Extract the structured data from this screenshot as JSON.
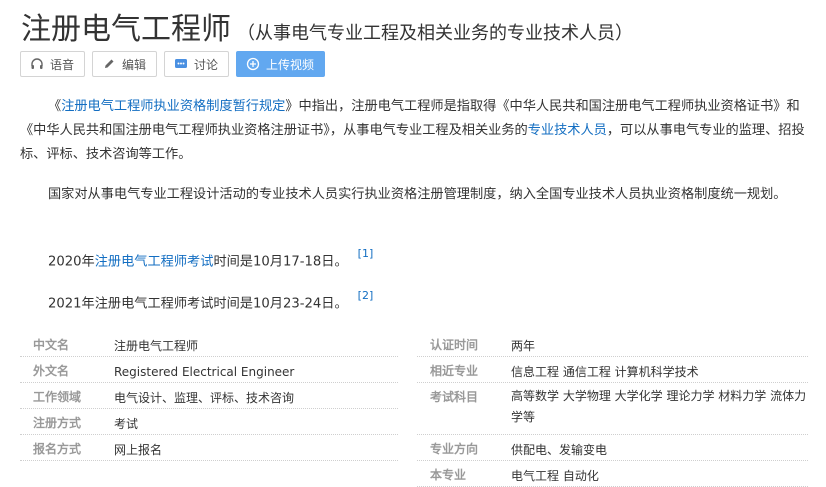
{
  "header": {
    "title": "注册电气工程师",
    "subtitle": "（从事电气专业工程及相关业务的专业技术人员）"
  },
  "toolbar": {
    "buttons": [
      {
        "label": "语音",
        "icon": "headphones-icon"
      },
      {
        "label": "编辑",
        "icon": "pencil-icon"
      },
      {
        "label": "讨论",
        "icon": "chat-icon"
      },
      {
        "label": "上传视频",
        "icon": "plus-circle-icon"
      }
    ]
  },
  "paragraphs": {
    "p1": {
      "a": "《",
      "link1": "注册电气工程师执业资格制度暂行规定",
      "b": "》中指出，注册电气工程师是指取得《中华人民共和国注册电气工程师执业资格证书》和《中华人民共和国注册电气工程师执业资格注册证书》，从事电气专业工程及相关业务的",
      "link2": "专业技术人员",
      "c": "，可以从事电气专业的监理、招投标、评标、技术咨询等工作。"
    },
    "p2": "国家对从事电气专业工程设计活动的专业技术人员实行执业资格注册管理制度，纳入全国专业技术人员执业资格制度统一规划。",
    "p3": {
      "a": "2020年",
      "link": "注册电气工程师考试",
      "b": "时间是10月17-18日。",
      "ref": "[1]"
    },
    "p4": {
      "text": "2021年注册电气工程师考试时间是10月23-24日。",
      "ref": "[2]"
    }
  },
  "info_left": [
    {
      "label": "中文名",
      "value": "注册电气工程师"
    },
    {
      "label": "外文名",
      "value": "Registered Electrical Engineer"
    },
    {
      "label": "工作领域",
      "value": "电气设计、监理、评标、技术咨询"
    },
    {
      "label": "注册方式",
      "value": "考试"
    },
    {
      "label": "报名方式",
      "value": "网上报名"
    }
  ],
  "info_right": [
    {
      "label": "认证时间",
      "value": "两年"
    },
    {
      "label": "相近专业",
      "value": "信息工程 通信工程 计算机科学技术"
    },
    {
      "label": "考试科目",
      "value": "高等数学 大学物理 大学化学 理论力学 材料力学 流体力学等"
    },
    {
      "label": "专业方向",
      "value": "供配电、发输变电"
    },
    {
      "label": "本专业",
      "value": "电气工程 自动化"
    }
  ],
  "colors": {
    "link": "#136ec2",
    "primary_button": "#62a8f0",
    "label": "#999999"
  }
}
